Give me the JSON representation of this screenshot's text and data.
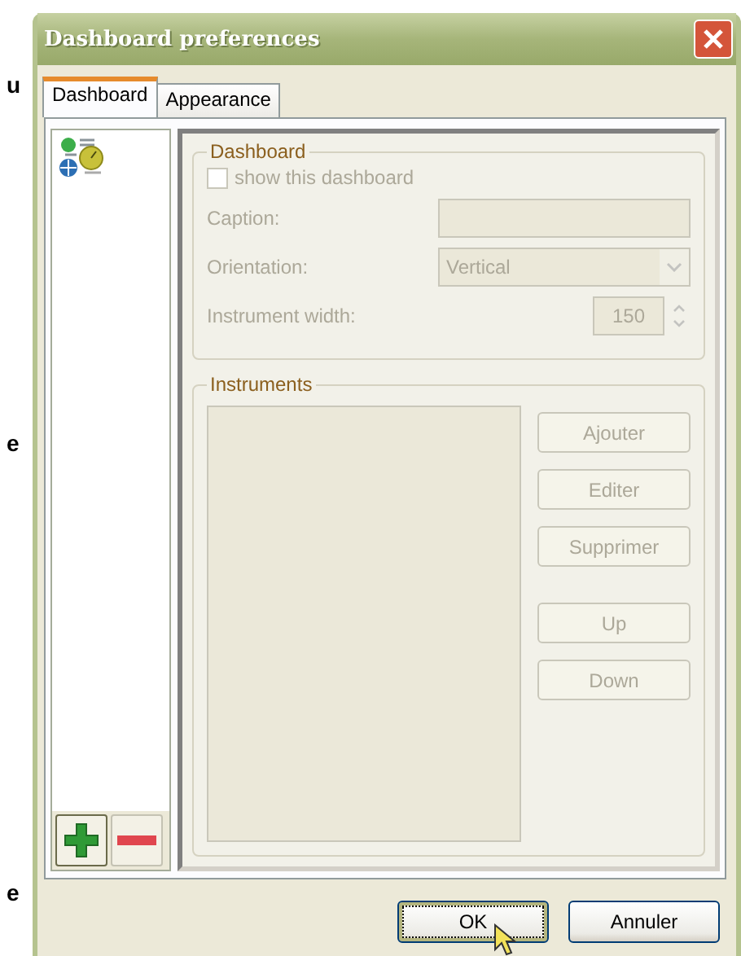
{
  "background_letters": [
    "u",
    "e",
    "e"
  ],
  "window": {
    "title": "Dashboard preferences"
  },
  "tabs": [
    {
      "label": "Dashboard",
      "selected": true
    },
    {
      "label": "Appearance",
      "selected": false
    }
  ],
  "list_buttons": [
    {
      "kind": "add"
    },
    {
      "kind": "remove"
    }
  ],
  "dashboard_group": {
    "title": "Dashboard",
    "disabled": true,
    "checkbox": {
      "label": "show this dashboard",
      "checked": false
    },
    "fields": [
      {
        "kind": "text",
        "label": "Caption:"
      },
      {
        "kind": "dropdown",
        "label": "Orientation:",
        "value": "Vertical"
      },
      {
        "kind": "spin",
        "label": "Instrument width:",
        "value": "150"
      }
    ]
  },
  "instruments_group": {
    "title": "Instruments",
    "disabled": true,
    "buttons": [
      "Ajouter",
      "Editer",
      "Supprimer",
      "Up",
      "Down"
    ]
  },
  "buttons": [
    {
      "label": "OK",
      "focused": true
    },
    {
      "label": "Annuler",
      "focused": false
    }
  ]
}
